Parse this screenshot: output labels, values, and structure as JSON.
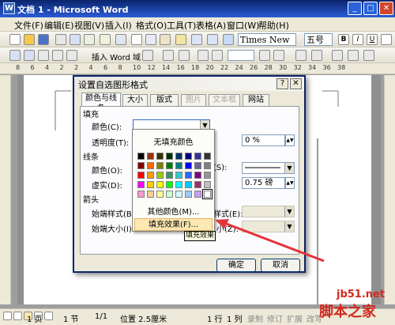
{
  "window": {
    "title": "文档 1 - Microsoft Word",
    "icon": "word-icon"
  },
  "menubar": [
    "文件(F)",
    "编辑(E)",
    "视图(V)",
    "插入(I)",
    "格式(O)",
    "工具(T)",
    "表格(A)",
    "窗口(W)",
    "帮助(H)"
  ],
  "toolbar": {
    "font_name": "Times New Roman",
    "font_size": "五号",
    "insert_word_label": "插入 Word 域"
  },
  "dialog": {
    "title": "设置自选图形格式",
    "tabs": [
      "颜色与线条",
      "大小",
      "版式",
      "图片",
      "文本框",
      "网站"
    ],
    "fill_section": "填充",
    "fill_color_label": "颜色(C):",
    "transparency_label": "透明度(T):",
    "transparency_value": "0 %",
    "line_section": "线条",
    "line_color_label": "颜色(O):",
    "dash_label": "虚实(D):",
    "weight_value": "0.75 磅",
    "style_suffix": "(S):",
    "arrows_section": "箭头",
    "begin_style_label": "始端样式(B):",
    "end_style_label": "样式(E):",
    "begin_size_label": "始端大小(I):",
    "end_size_label": "小(Z):",
    "ok_label": "确定",
    "cancel_label": "取消"
  },
  "color_popup": {
    "no_fill": "无填充颜色",
    "more_colors": "其他颜色(M)...",
    "fill_effects": "填充效果(F)...",
    "tooltip": "填充效果",
    "swatch_rows": [
      [
        "#000000",
        "#993300",
        "#333300",
        "#003300",
        "#003366",
        "#000080",
        "#333399",
        "#333333"
      ],
      [
        "#800000",
        "#ff6600",
        "#808000",
        "#008000",
        "#008080",
        "#0000ff",
        "#666699",
        "#808080"
      ],
      [
        "#ff0000",
        "#ff9900",
        "#99cc00",
        "#339966",
        "#33cccc",
        "#3366ff",
        "#800080",
        "#969696"
      ],
      [
        "#ff00ff",
        "#ffcc00",
        "#ffff00",
        "#00ff00",
        "#00ffff",
        "#00ccff",
        "#993366",
        "#c0c0c0"
      ],
      [
        "#ff99cc",
        "#ffcc99",
        "#ffff99",
        "#ccffcc",
        "#ccffff",
        "#99ccff",
        "#cc99ff",
        "#ffffff"
      ]
    ]
  },
  "ruler_numbers": [
    "8",
    "6",
    "4",
    "2",
    "2",
    "4",
    "6",
    "8",
    "10",
    "12",
    "14",
    "16",
    "18",
    "20",
    "22",
    "24",
    "26",
    "28",
    "30",
    "32",
    "34",
    "36",
    "38"
  ],
  "status": {
    "page": "1 页",
    "section": "1 节",
    "page_of": "1/1",
    "position": "位置 2.5厘米",
    "line": "1 行",
    "column": "1 列",
    "rec": "录制",
    "trk": "修订",
    "ext": "扩展",
    "ovr": "改写"
  },
  "watermark": {
    "line1": "jb51.net",
    "line2": "脚本之家"
  }
}
